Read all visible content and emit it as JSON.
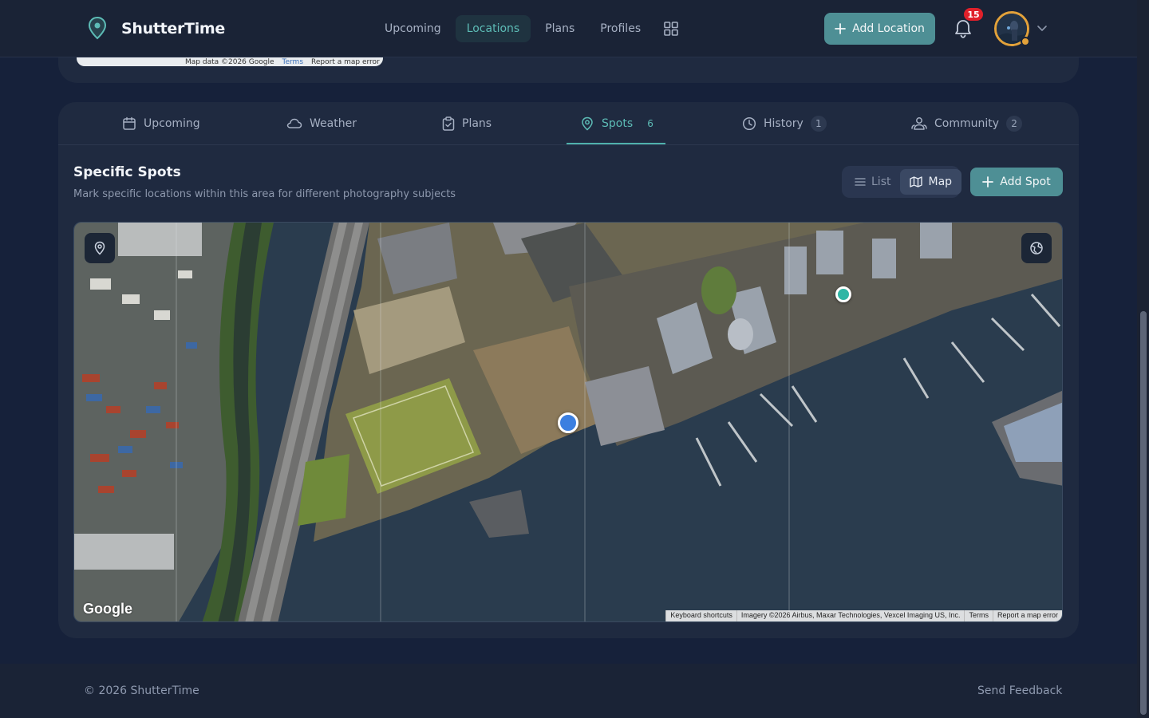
{
  "app": {
    "brand": "ShutterTime",
    "nav": [
      "Upcoming",
      "Locations",
      "Plans",
      "Profiles"
    ],
    "active_nav": "Locations",
    "add_location_label": "Add Location",
    "notification_count": "15",
    "icons": {
      "brand": "map-pin-icon",
      "grid": "grid-icon",
      "bell": "bell-icon",
      "chevron": "chevron-down-icon",
      "plus": "plus-icon"
    }
  },
  "mini_map": {
    "map_data": "Map data ©2026 Google",
    "terms": "Terms",
    "report": "Report a map error"
  },
  "tabs": [
    {
      "label": "Upcoming",
      "count": "",
      "icon": "calendar-icon"
    },
    {
      "label": "Weather",
      "count": "",
      "icon": "cloud-icon"
    },
    {
      "label": "Plans",
      "count": "",
      "icon": "clipboard-icon"
    },
    {
      "label": "Spots",
      "count": "6",
      "icon": "map-pin-icon"
    },
    {
      "label": "History",
      "count": "1",
      "icon": "clock-icon"
    },
    {
      "label": "Community",
      "count": "2",
      "icon": "users-icon"
    }
  ],
  "active_tab": "Spots",
  "spots": {
    "title": "Specific Spots",
    "subtitle": "Mark specific locations within this area for different photography subjects",
    "view_list": "List",
    "view_map": "Map",
    "active_view": "Map",
    "add_spot_label": "Add Spot"
  },
  "map": {
    "logo": "Google",
    "attribution": [
      "Keyboard shortcuts",
      "Imagery ©2026 Airbus, Maxar Technologies, Vexcel Imaging US, Inc.",
      "Terms",
      "Report a map error"
    ],
    "markers": [
      {
        "name": "blue-spot-marker",
        "color": "#3b7fe0"
      },
      {
        "name": "teal-spot-marker",
        "color": "#2fb6a5"
      }
    ]
  },
  "footer": {
    "copyright": "© 2026 ShutterTime",
    "feedback": "Send Feedback"
  },
  "colors": {
    "accent": "#4e8f95",
    "accent_text": "#5dbcb6",
    "badge": "#e0202a",
    "avatar_ring": "#e3a23a"
  }
}
